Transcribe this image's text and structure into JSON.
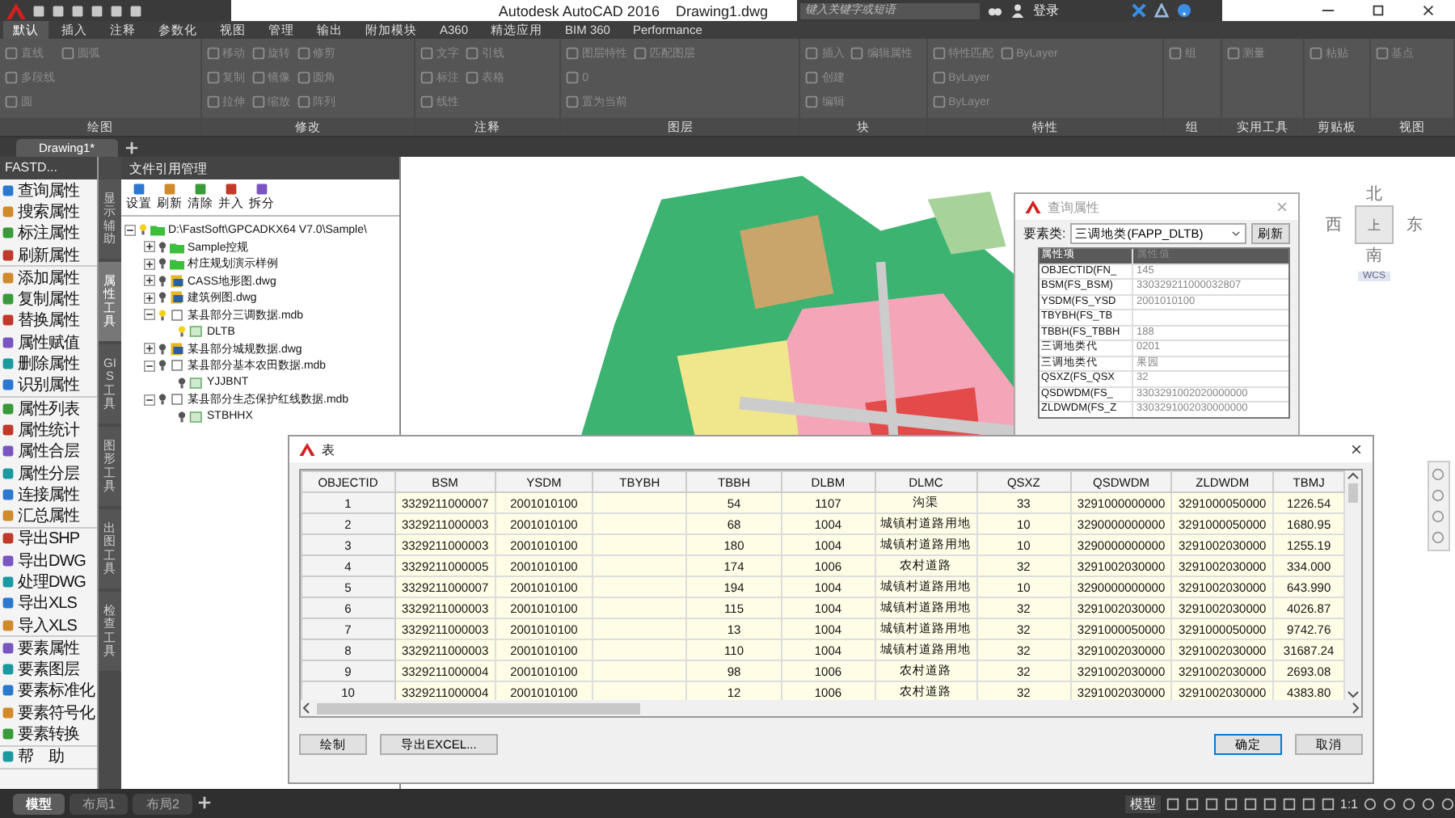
{
  "title_bar": {
    "title": "Autodesk AutoCAD 2016",
    "document": "Drawing1.dwg",
    "search": {
      "placeholder": "键入关键字或短语"
    },
    "login": "登录"
  },
  "ribbon_tabs": [
    {
      "label": "默认",
      "selected": true
    },
    {
      "label": "插入",
      "selected": false
    },
    {
      "label": "注释",
      "selected": false
    },
    {
      "label": "参数化",
      "selected": false
    },
    {
      "label": "视图",
      "selected": false
    },
    {
      "label": "管理",
      "selected": false
    },
    {
      "label": "输出",
      "selected": false
    },
    {
      "label": "附加模块",
      "selected": false
    },
    {
      "label": "A360",
      "selected": false
    },
    {
      "label": "精选应用",
      "selected": false
    },
    {
      "label": "BIM 360",
      "selected": false
    },
    {
      "label": "Performance",
      "selected": false
    }
  ],
  "ribbon_panels": [
    {
      "title": "绘图",
      "tools": [
        "直线",
        "多段线",
        "圆",
        "圆弧"
      ]
    },
    {
      "title": "修改",
      "tools": [
        "移动",
        "复制",
        "拉伸",
        "旋转",
        "镜像",
        "缩放",
        "修剪",
        "圆角",
        "阵列"
      ]
    },
    {
      "title": "注释",
      "tools": [
        "文字",
        "标注",
        "线性",
        "引线",
        "表格"
      ]
    },
    {
      "title": "图层",
      "tools": [
        "图层特性",
        "0",
        "置为当前",
        "匹配图层"
      ]
    },
    {
      "title": "块",
      "tools": [
        "插入",
        "创建",
        "编辑",
        "编辑属性"
      ]
    },
    {
      "title": "特性",
      "tools": [
        "特性匹配",
        "ByLayer",
        "ByLayer",
        "ByLayer"
      ]
    },
    {
      "title": "组",
      "tools": [
        "组"
      ]
    },
    {
      "title": "实用工具",
      "tools": [
        "测量"
      ]
    },
    {
      "title": "剪贴板",
      "tools": [
        "粘贴"
      ]
    },
    {
      "title": "视图",
      "tools": [
        "基点"
      ]
    }
  ],
  "document_tabs": [
    {
      "label": "Drawing1*",
      "selected": true
    }
  ],
  "fastd_panel": {
    "title": "FASTD...",
    "groups": [
      [
        "查询属性",
        "搜索属性",
        "标注属性",
        "刷新属性"
      ],
      [
        "添加属性",
        "复制属性",
        "替换属性",
        "属性赋值",
        "删除属性",
        "识别属性"
      ],
      [
        "属性列表",
        "属性统计",
        "属性合层",
        "属性分层",
        "连接属性",
        "汇总属性"
      ],
      [
        "导出SHP",
        "导出DWG",
        "处理DWG",
        "导出XLS",
        "导入XLS"
      ],
      [
        "要素属性",
        "要素图层",
        "要素标准化",
        "要素符号化",
        "要素转换"
      ],
      [
        "帮　助"
      ]
    ]
  },
  "side_tabs": [
    {
      "label": "显示辅助",
      "selected": false
    },
    {
      "label": "属性工具",
      "selected": true
    },
    {
      "label": "GIS工具",
      "selected": false
    },
    {
      "label": "图形工具",
      "selected": false
    },
    {
      "label": "出图工具",
      "selected": false
    },
    {
      "label": "检查工具",
      "selected": false
    }
  ],
  "file_manager": {
    "title": "文件引用管理",
    "toolbar": [
      "设置",
      "刷新",
      "清除",
      "并入",
      "拆分"
    ],
    "tree": [
      {
        "label": "D:\\FastSoft\\GPCADKX64 V7.0\\Sample\\",
        "kind": "folder",
        "lit": true,
        "expanded": true,
        "children": [
          {
            "label": "Sample控规",
            "kind": "folder",
            "lit": false,
            "expanded": false
          },
          {
            "label": "村庄规划演示样例",
            "kind": "folder",
            "lit": false,
            "expanded": false
          },
          {
            "label": "CASS地形图.dwg",
            "kind": "dwg",
            "lit": false,
            "expanded": false
          },
          {
            "label": "建筑例图.dwg",
            "kind": "dwg",
            "lit": false,
            "expanded": false
          },
          {
            "label": "某县部分三调数据.mdb",
            "kind": "mdb",
            "lit": true,
            "expanded": true,
            "children": [
              {
                "label": "DLTB",
                "kind": "layer",
                "lit": true
              }
            ]
          },
          {
            "label": "某县部分城规数据.dwg",
            "kind": "dwg",
            "lit": false,
            "expanded": false
          },
          {
            "label": "某县部分基本农田数据.mdb",
            "kind": "mdb",
            "lit": false,
            "expanded": true,
            "children": [
              {
                "label": "YJJBNT",
                "kind": "layer",
                "lit": false
              }
            ]
          },
          {
            "label": "某县部分生态保护红线数据.mdb",
            "kind": "mdb",
            "lit": false,
            "expanded": true,
            "children": [
              {
                "label": "STBHHX",
                "kind": "layer",
                "lit": false
              }
            ]
          }
        ]
      }
    ]
  },
  "viewcube": {
    "north": "北",
    "south": "南",
    "east": "东",
    "west": "西",
    "face": "上",
    "ucs": "WCS"
  },
  "query_dialog": {
    "title": "查询属性",
    "class_label": "要素类:",
    "class_value": "三调地类(FAPP_DLTB)",
    "refresh": "刷新",
    "header": [
      "属性项",
      "属性值"
    ],
    "rows": [
      {
        "name": "OBJECTID(FN_",
        "value": "145"
      },
      {
        "name": "BSM(FS_BSM)",
        "value": "330329211000032807"
      },
      {
        "name": "YSDM(FS_YSD",
        "value": "2001010100"
      },
      {
        "name": "TBYBH(FS_TB",
        "value": ""
      },
      {
        "name": "TBBH(FS_TBBH",
        "value": "188"
      },
      {
        "name": "三调地类代",
        "value": "0201"
      },
      {
        "name": "三调地类代",
        "value": "果园"
      },
      {
        "name": "QSXZ(FS_QSX",
        "value": "32"
      },
      {
        "name": "QSDWDM(FS_",
        "value": "3303291002020000000"
      },
      {
        "name": "ZLDWDM(FS_Z",
        "value": "3303291002030000000"
      }
    ]
  },
  "table_dialog": {
    "title": "表",
    "columns": [
      "OBJECTID",
      "BSM",
      "YSDM",
      "TBYBH",
      "TBBH",
      "DLBM",
      "DLMC",
      "QSXZ",
      "QSDWDM",
      "ZLDWDM",
      "TBMJ"
    ],
    "rows": [
      [
        "1",
        "3329211000007",
        "2001010100",
        "",
        "54",
        "1107",
        "沟渠",
        "33",
        "3291000000000",
        "3291000050000",
        "1226.54"
      ],
      [
        "2",
        "3329211000003",
        "2001010100",
        "",
        "68",
        "1004",
        "城镇村道路用地",
        "10",
        "3290000000000",
        "3291000050000",
        "1680.95"
      ],
      [
        "3",
        "3329211000003",
        "2001010100",
        "",
        "180",
        "1004",
        "城镇村道路用地",
        "10",
        "3290000000000",
        "3291002030000",
        "1255.19"
      ],
      [
        "4",
        "3329211000005",
        "2001010100",
        "",
        "174",
        "1006",
        "农村道路",
        "32",
        "3291002030000",
        "3291002030000",
        "334.000"
      ],
      [
        "5",
        "3329211000007",
        "2001010100",
        "",
        "194",
        "1004",
        "城镇村道路用地",
        "10",
        "3290000000000",
        "3291002030000",
        "643.990"
      ],
      [
        "6",
        "3329211000003",
        "2001010100",
        "",
        "115",
        "1004",
        "城镇村道路用地",
        "32",
        "3291002030000",
        "3291002030000",
        "4026.87"
      ],
      [
        "7",
        "3329211000003",
        "2001010100",
        "",
        "13",
        "1004",
        "城镇村道路用地",
        "32",
        "3291000050000",
        "3291000050000",
        "9742.76"
      ],
      [
        "8",
        "3329211000003",
        "2001010100",
        "",
        "110",
        "1004",
        "城镇村道路用地",
        "32",
        "3291002030000",
        "3291002030000",
        "31687.24"
      ],
      [
        "9",
        "3329211000004",
        "2001010100",
        "",
        "98",
        "1006",
        "农村道路",
        "32",
        "3291002030000",
        "3291002030000",
        "2693.08"
      ],
      [
        "10",
        "3329211000004",
        "2001010100",
        "",
        "12",
        "1006",
        "农村道路",
        "32",
        "3291002030000",
        "3291002030000",
        "4383.80"
      ]
    ],
    "buttons": [
      {
        "label": "绘制",
        "kind": "normal"
      },
      {
        "label": "导出EXCEL...",
        "kind": "normal"
      },
      {
        "label": "确定",
        "kind": "default"
      },
      {
        "label": "取消",
        "kind": "normal"
      }
    ]
  },
  "layout_tabs": [
    {
      "label": "模型",
      "selected": true
    },
    {
      "label": "布局1",
      "selected": false
    },
    {
      "label": "布局2",
      "selected": false
    }
  ],
  "status_bar": {
    "space": "模型",
    "scale": "1:1"
  }
}
